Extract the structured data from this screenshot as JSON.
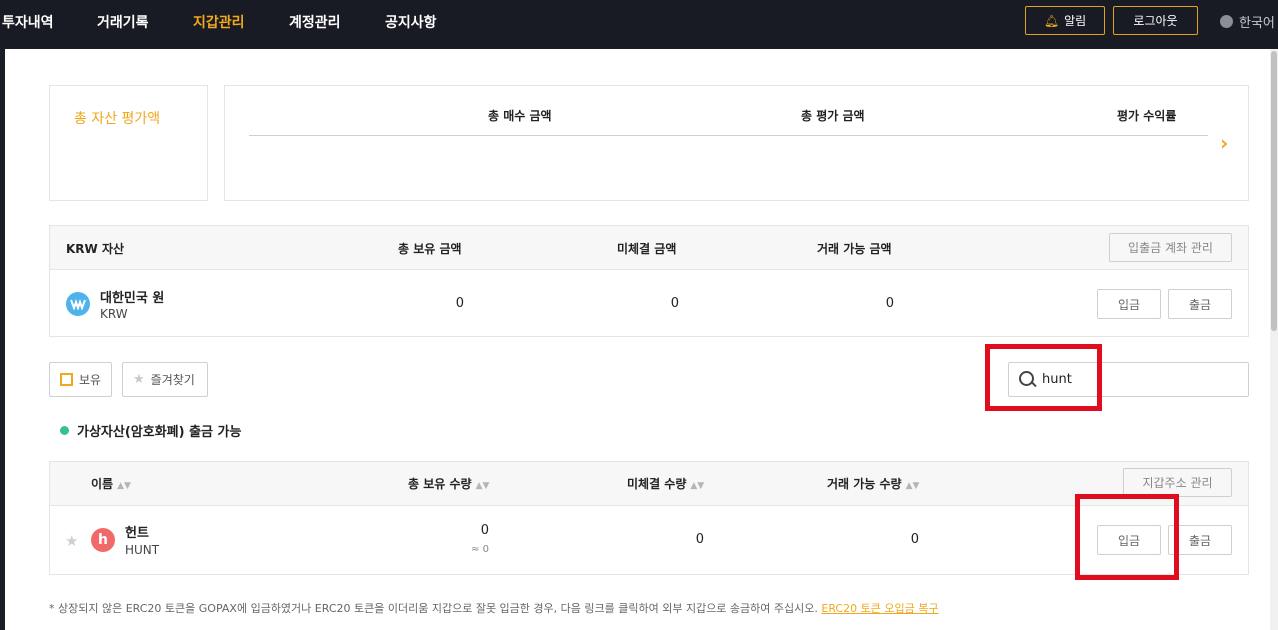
{
  "nav": {
    "items": [
      "투자내역",
      "거래기록",
      "지갑관리",
      "계정관리",
      "공지사항"
    ],
    "active_index": 2,
    "alert_label": "알림",
    "logout_label": "로그아웃",
    "language": "한국어"
  },
  "summary": {
    "total_label": "총 자산 평가액",
    "headers": [
      "총 매수 금액",
      "총 평가 금액",
      "평가 수익률"
    ]
  },
  "krw": {
    "headers": [
      "KRW 자산",
      "총 보유 금액",
      "미체결 금액",
      "거래 가능 금액"
    ],
    "manage_button": "입출금 계좌 관리",
    "row": {
      "name": "대한민국 원",
      "symbol": "KRW",
      "total": "0",
      "pending": "0",
      "available": "0"
    },
    "deposit": "입금",
    "withdraw": "출금"
  },
  "filters": {
    "holding": "보유",
    "favorites": "즐겨찾기",
    "search_value": "hunt"
  },
  "crypto": {
    "status": "가상자산(암호화폐) 출금 가능",
    "headers": [
      "이름",
      "총 보유 수량",
      "미체결 수량",
      "거래 가능 수량"
    ],
    "manage_button": "지갑주소 관리",
    "row": {
      "name": "헌트",
      "symbol": "HUNT",
      "total": "0",
      "total_approx": "≈ 0",
      "pending": "0",
      "available": "0"
    },
    "deposit": "입금",
    "withdraw": "출금"
  },
  "footnote": {
    "text": "* 상장되지 않은 ERC20 토큰을 GOPAX에 입금하였거나 ERC20 토큰을 이더리움 지갑으로 잘못 입금한 경우, 다음 링크를 클릭하여 외부 지갑으로 송금하여 주십시오.",
    "link": "ERC20 토큰 오입금 복구"
  },
  "colors": {
    "accent": "#f0a81e",
    "highlight": "#e00d1e",
    "krw_icon": "#4db3ea",
    "hunt_icon": "#f06a6a",
    "status_dot": "#35c28a"
  }
}
